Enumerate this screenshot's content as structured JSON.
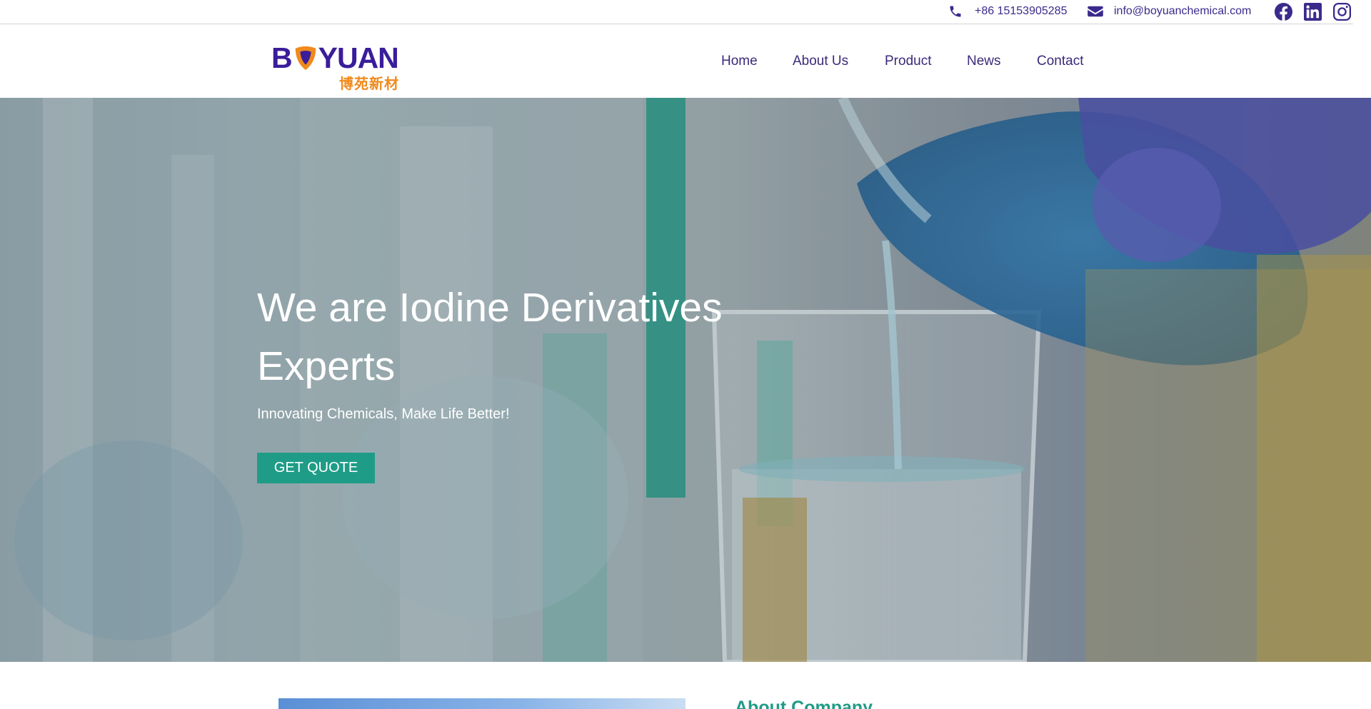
{
  "topbar": {
    "phone": "+86 15153905285",
    "email": "info@boyuanchemical.com",
    "social": [
      "facebook-icon",
      "linkedin-icon",
      "instagram-icon"
    ],
    "icon_color": "#3b2a8c"
  },
  "header": {
    "logo_text": "BOYUAN",
    "logo_text_before": "B",
    "logo_text_after": "YUAN",
    "logo_cn": "博苑新材",
    "nav": [
      {
        "label": "Home"
      },
      {
        "label": "About Us"
      },
      {
        "label": "Product"
      },
      {
        "label": "News"
      },
      {
        "label": "Contact"
      }
    ]
  },
  "hero": {
    "title": "We are Iodine Derivatives Experts",
    "subtitle": "Innovating Chemicals, Make Life Better!",
    "cta": "GET QUOTE",
    "accent": "#1f9c87"
  },
  "about": {
    "heading": "About Company"
  },
  "colors": {
    "brand_purple": "#3a1d9a",
    "brand_orange": "#f08a1c",
    "accent_teal": "#1f9c87",
    "nav_text": "#3b2a7a"
  }
}
